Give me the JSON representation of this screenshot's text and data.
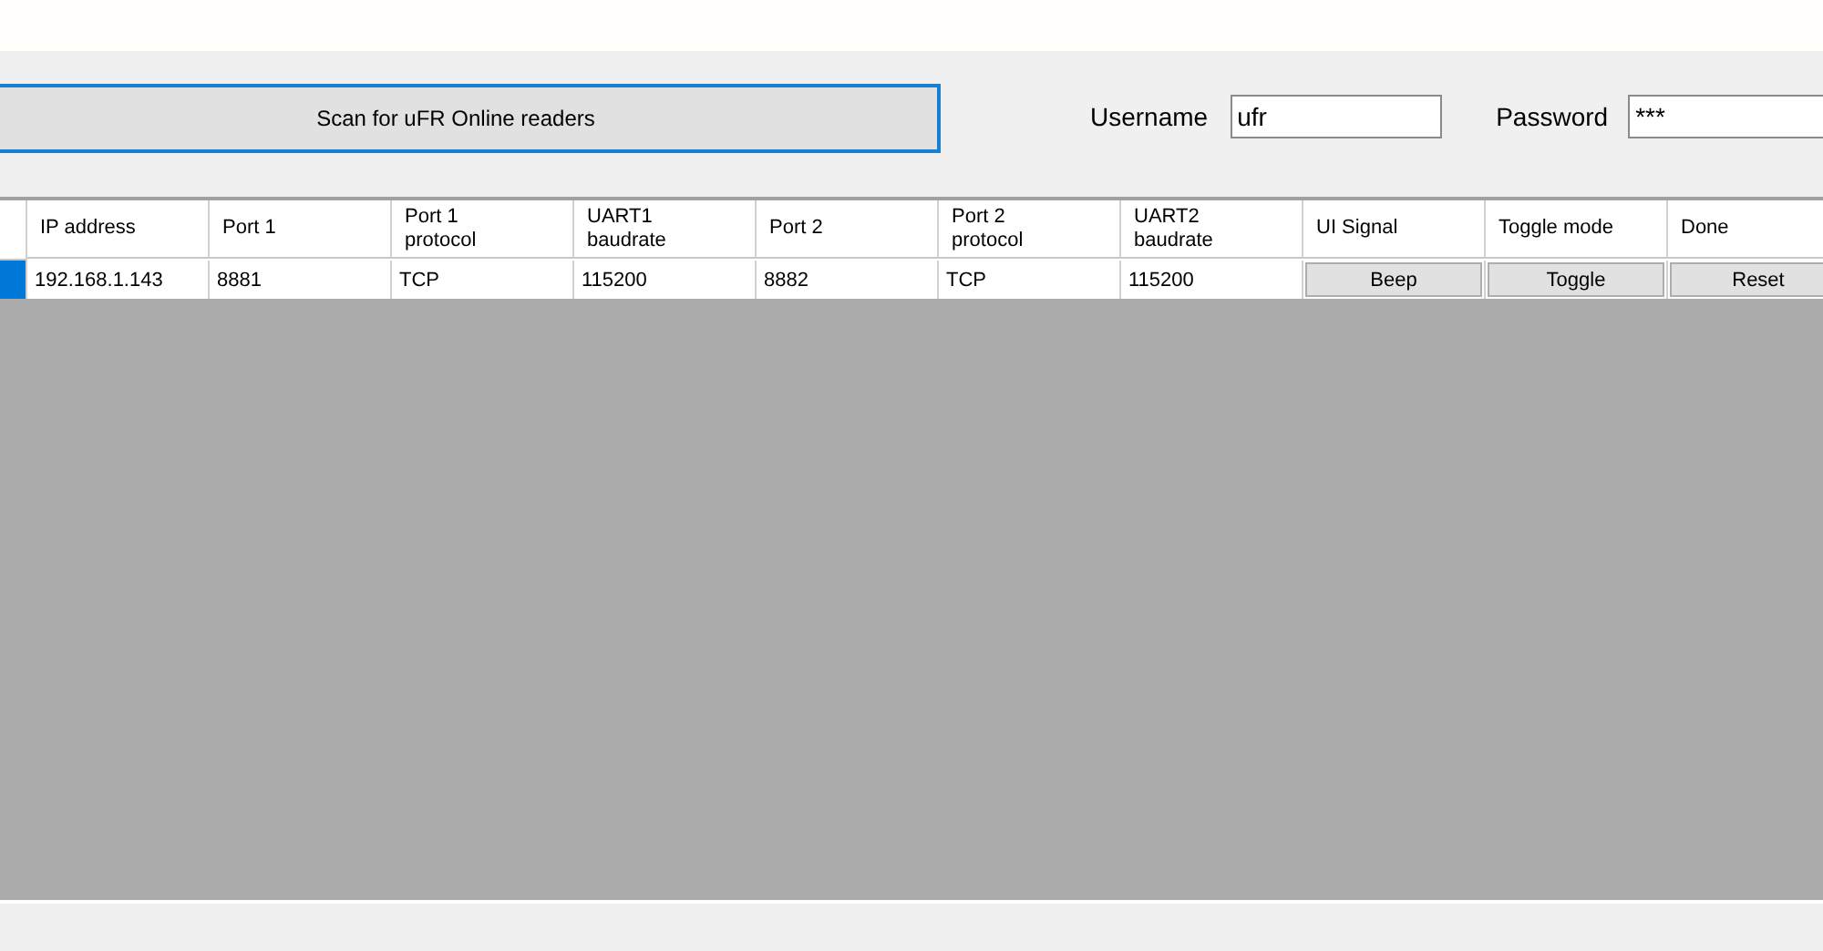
{
  "scan_button": {
    "label": "Scan for uFR Online readers"
  },
  "username": {
    "label": "Username",
    "value": "ufr"
  },
  "password": {
    "label": "Password",
    "value": "***"
  },
  "table": {
    "columns": [
      {
        "label": "IP address",
        "kind": "text"
      },
      {
        "label": "Port 1",
        "kind": "text"
      },
      {
        "label": "Port 1\nprotocol",
        "kind": "text"
      },
      {
        "label": "UART1\nbaudrate",
        "kind": "text"
      },
      {
        "label": "Port 2",
        "kind": "text"
      },
      {
        "label": "Port 2\nprotocol",
        "kind": "text"
      },
      {
        "label": "UART2\nbaudrate",
        "kind": "text"
      },
      {
        "label": "UI Signal",
        "kind": "button"
      },
      {
        "label": "Toggle mode",
        "kind": "button"
      },
      {
        "label": "Done",
        "kind": "button"
      }
    ],
    "rows": [
      {
        "selected": true,
        "cells": [
          "192.168.1.143",
          "8881",
          "TCP",
          "115200",
          "8882",
          "TCP",
          "115200",
          "Beep",
          "Toggle",
          "Reset"
        ]
      }
    ]
  }
}
